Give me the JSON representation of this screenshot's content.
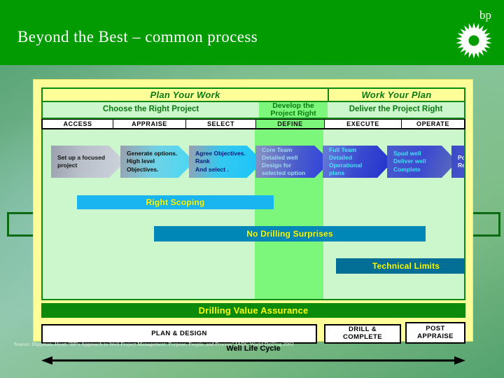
{
  "header": {
    "title": "Beyond the Best – common process",
    "brand_word": "bp",
    "logo_name": "helios-sunflower-logo",
    "band_color": "#029c02"
  },
  "diagram": {
    "phase_row": [
      {
        "label": "Plan Your Work"
      },
      {
        "label": "Work Your Plan"
      }
    ],
    "objective_row": [
      {
        "label": "Choose the Right Project"
      },
      {
        "label": "Develop the\nProject Right",
        "highlight": true
      },
      {
        "label": "Deliver the Project Right"
      }
    ],
    "stage_row": [
      {
        "label": "ACCESS"
      },
      {
        "label": "APPRAISE"
      },
      {
        "label": "SELECT"
      },
      {
        "label": "DEFINE",
        "highlight": true
      },
      {
        "label": "EXECUTE"
      },
      {
        "label": "OPERATE"
      }
    ],
    "arrows": [
      {
        "stage": "ACCESS",
        "lines": [
          "Set  up a focused",
          "project"
        ]
      },
      {
        "stage": "APPRAISE",
        "lines": [
          "Generate options.",
          "High level",
          "Objectives."
        ]
      },
      {
        "stage": "SELECT",
        "lines": [
          "Agree Objectives.",
          "Rank",
          "And select ."
        ]
      },
      {
        "stage": "DEFINE",
        "lines": [
          "Core Team",
          "Detailed well",
          "Design for",
          "selected option"
        ]
      },
      {
        "stage": "EXECUTE1",
        "lines": [
          "Full  Team",
          "Detailed",
          "Operational",
          "plans"
        ]
      },
      {
        "stage": "EXECUTE2",
        "lines": [
          "Spud well",
          "Deliver well",
          "Complete"
        ]
      },
      {
        "stage": "OPERATE",
        "lines": [
          "Post  Well",
          "Review"
        ]
      }
    ],
    "value_bars": [
      {
        "label": "Right Scoping",
        "color": "#19b5f0"
      },
      {
        "label": "No Drilling Surprises",
        "color": "#0087b8"
      },
      {
        "label": "Technical Limits",
        "color": "#046f96"
      }
    ],
    "assurance_bar": {
      "label": "Drilling Value Assurance",
      "color": "#0b8a0b",
      "text_color": "#ffff00"
    },
    "life_cycle": {
      "boxes": [
        {
          "label": "PLAN & DESIGN"
        },
        {
          "label": "DRILL &\nCOMPLETE"
        },
        {
          "label": "POST\nAPPRAISE"
        }
      ],
      "axis_label": "Well Life Cycle"
    }
  },
  "source_note": "Source: Hippman, Hyatt \"BP's Approach to Well Project Management: Purpose, People, and Process\" IADC World Drilling 2002"
}
